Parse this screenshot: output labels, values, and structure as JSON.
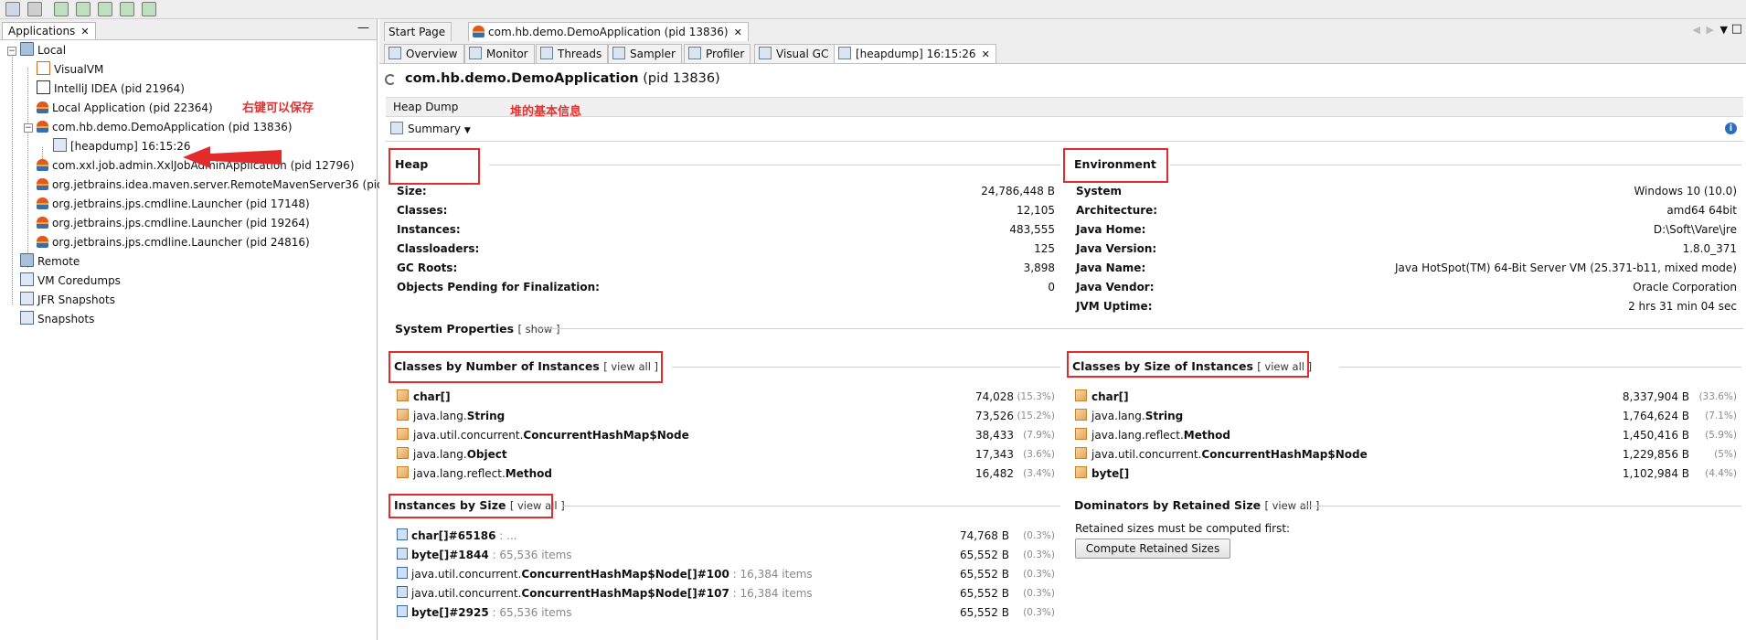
{
  "left_panel": {
    "tab_label": "Applications",
    "tree": {
      "local": "Local",
      "visualvm": "VisualVM",
      "intellij": "IntelliJ IDEA (pid 21964)",
      "local_app": "Local Application (pid 22364)",
      "demo_app": "com.hb.demo.DemoApplication (pid 13836)",
      "heapdump": "[heapdump] 16:15:26",
      "xxl": "com.xxl.job.admin.XxlJobAdminApplication (pid 12796)",
      "maven": "org.jetbrains.idea.maven.server.RemoteMavenServer36 (pid",
      "launcher1": "org.jetbrains.jps.cmdline.Launcher (pid 17148)",
      "launcher2": "org.jetbrains.jps.cmdline.Launcher (pid 19264)",
      "launcher3": "org.jetbrains.jps.cmdline.Launcher (pid 24816)",
      "remote": "Remote",
      "vm_coredumps": "VM Coredumps",
      "jfr": "JFR Snapshots",
      "snapshots": "Snapshots"
    },
    "annotation": "右键可以保存"
  },
  "doc_tabs": {
    "start_page": "Start Page",
    "demo_tab": "com.hb.demo.DemoApplication (pid 13836)"
  },
  "sub_tabs": [
    "Overview",
    "Monitor",
    "Threads",
    "Sampler",
    "Profiler",
    "Visual GC",
    "[heapdump] 16:15:26"
  ],
  "page": {
    "title": "com.hb.demo.DemoApplication",
    "pid": "(pid 13836)",
    "heap_dump_label": "Heap Dump",
    "heap_annotation": "堆的基本信息",
    "summary_label": "Summary"
  },
  "heap": {
    "title": "Heap",
    "rows": [
      {
        "label": "Size:",
        "value": "24,786,448 B"
      },
      {
        "label": "Classes:",
        "value": "12,105"
      },
      {
        "label": "Instances:",
        "value": "483,555"
      },
      {
        "label": "Classloaders:",
        "value": "125"
      },
      {
        "label": "GC Roots:",
        "value": "3,898"
      },
      {
        "label": "Objects Pending for Finalization:",
        "value": "0"
      }
    ]
  },
  "environment": {
    "title": "Environment",
    "rows": [
      {
        "label": "System",
        "value": "Windows 10 (10.0)"
      },
      {
        "label": "Architecture:",
        "value": "amd64 64bit"
      },
      {
        "label": "Java Home:",
        "value": "D:\\Soft\\Vare\\jre"
      },
      {
        "label": "Java Version:",
        "value": "1.8.0_371"
      },
      {
        "label": "Java Name:",
        "value": "Java HotSpot(TM) 64-Bit Server VM (25.371-b11, mixed mode)"
      },
      {
        "label": "Java Vendor:",
        "value": "Oracle Corporation"
      },
      {
        "label": "JVM Uptime:",
        "value": "2 hrs 31 min 04 sec"
      }
    ]
  },
  "system_properties": {
    "title": "System Properties",
    "link": "[ show ]"
  },
  "classes_by_count": {
    "title": "Classes by Number of Instances",
    "link": "[ view all ]",
    "rows": [
      {
        "pkg": "",
        "cls": "char[]",
        "value": "74,028",
        "pct": "(15.3%)"
      },
      {
        "pkg": "java.lang.",
        "cls": "String",
        "value": "73,526",
        "pct": "(15.2%)"
      },
      {
        "pkg": "java.util.concurrent.",
        "cls": "ConcurrentHashMap$Node",
        "value": "38,433",
        "pct": "(7.9%)"
      },
      {
        "pkg": "java.lang.",
        "cls": "Object",
        "value": "17,343",
        "pct": "(3.6%)"
      },
      {
        "pkg": "java.lang.reflect.",
        "cls": "Method",
        "value": "16,482",
        "pct": "(3.4%)"
      }
    ]
  },
  "classes_by_size": {
    "title": "Classes by Size of Instances",
    "link": "[ view all ]",
    "rows": [
      {
        "pkg": "",
        "cls": "char[]",
        "value": "8,337,904 B",
        "pct": "(33.6%)"
      },
      {
        "pkg": "java.lang.",
        "cls": "String",
        "value": "1,764,624 B",
        "pct": "(7.1%)"
      },
      {
        "pkg": "java.lang.reflect.",
        "cls": "Method",
        "value": "1,450,416 B",
        "pct": "(5.9%)"
      },
      {
        "pkg": "java.util.concurrent.",
        "cls": "ConcurrentHashMap$Node",
        "value": "1,229,856 B",
        "pct": "(5%)"
      },
      {
        "pkg": "",
        "cls": "byte[]",
        "value": "1,102,984 B",
        "pct": "(4.4%)"
      }
    ]
  },
  "instances_by_size": {
    "title": "Instances by Size",
    "link": "[ view all ]",
    "rows": [
      {
        "pkg": "",
        "cls": "char[]#65186",
        "extra": ": ...",
        "value": "74,768 B",
        "pct": "(0.3%)"
      },
      {
        "pkg": "",
        "cls": "byte[]#1844",
        "extra": ": 65,536 items",
        "value": "65,552 B",
        "pct": "(0.3%)"
      },
      {
        "pkg": "java.util.concurrent.",
        "cls": "ConcurrentHashMap$Node[]#100",
        "extra": ": 16,384 items",
        "value": "65,552 B",
        "pct": "(0.3%)"
      },
      {
        "pkg": "java.util.concurrent.",
        "cls": "ConcurrentHashMap$Node[]#107",
        "extra": ": 16,384 items",
        "value": "65,552 B",
        "pct": "(0.3%)"
      },
      {
        "pkg": "",
        "cls": "byte[]#2925",
        "extra": ": 65,536 items",
        "value": "65,552 B",
        "pct": "(0.3%)"
      }
    ]
  },
  "dominators": {
    "title": "Dominators by Retained Size",
    "link": "[ view all ]",
    "note": "Retained sizes must be computed first:",
    "button": "Compute Retained Sizes"
  },
  "colors": {
    "annotation_red": "#e42b2b",
    "link_blue": "#2a5aa8"
  }
}
